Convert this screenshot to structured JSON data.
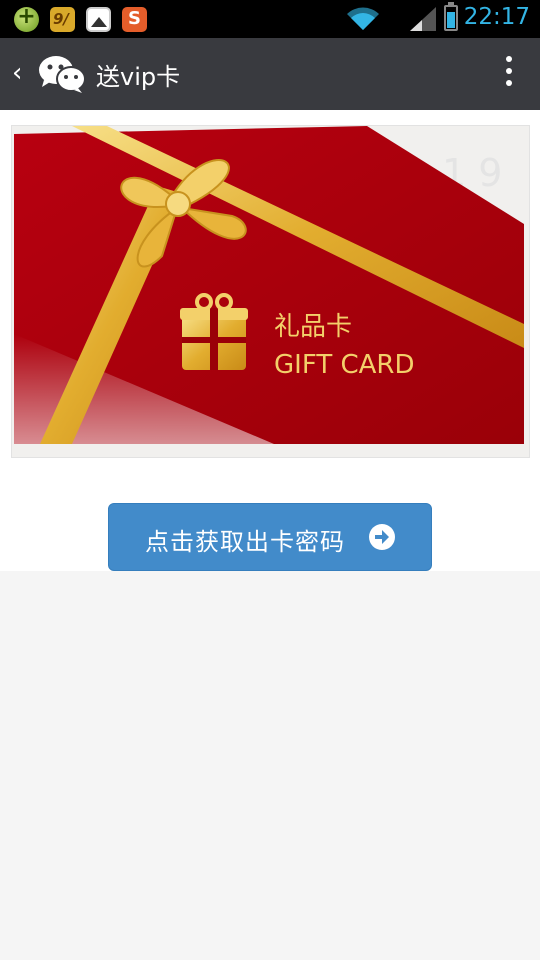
{
  "status_bar": {
    "time": "22:17",
    "app_icon_2_text": "9/",
    "app_icon_4_text": "S"
  },
  "header": {
    "back_label": "‹",
    "title": "送vip卡"
  },
  "card": {
    "title_cn": "礼品卡",
    "title_en": "GIFT CARD"
  },
  "cta": {
    "label": "点击获取出卡密码"
  },
  "colors": {
    "header_bg": "#393a3f",
    "card_red": "#a8000a",
    "ribbon_gold": "#e8b73a",
    "button_blue": "#428bca"
  }
}
